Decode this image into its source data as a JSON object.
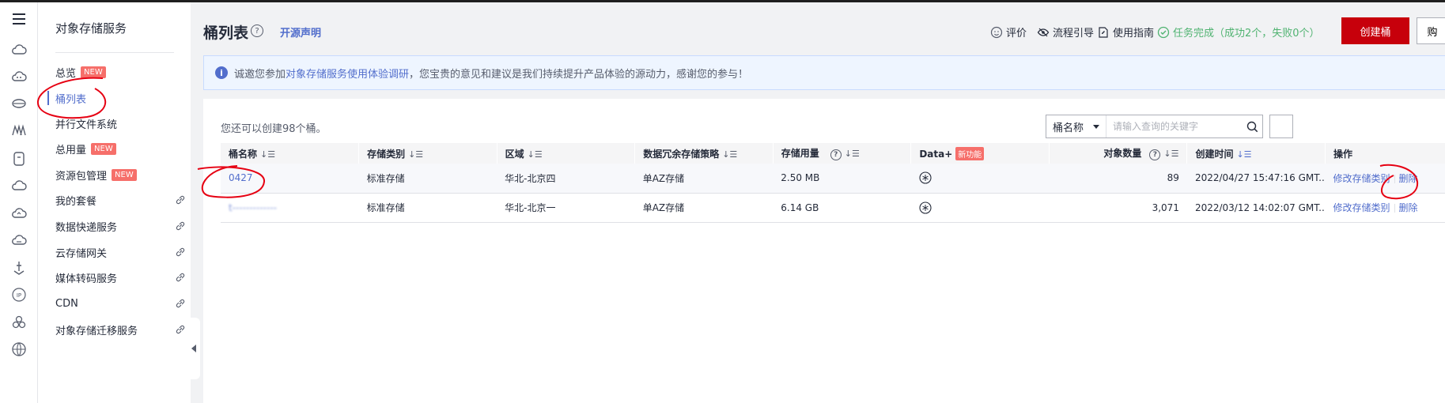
{
  "rail_icons": [
    "menu-icon",
    "cloud-icon",
    "cloud-server-icon",
    "storage-disk-icon",
    "ma-icon",
    "bucket-icon",
    "cloud-icon",
    "cloud-outline-icon",
    "cloud-sync-icon",
    "ship-icon",
    "ip-icon",
    "cluster-icon",
    "globe-icon"
  ],
  "nav": {
    "service_title": "对象存储服务",
    "items": [
      {
        "label": "总览",
        "badge": "NEW"
      },
      {
        "label": "桶列表",
        "badge": ""
      },
      {
        "label": "并行文件系统",
        "badge": ""
      },
      {
        "label": "总用量",
        "badge": "NEW"
      },
      {
        "label": "资源包管理",
        "badge": "NEW"
      },
      {
        "label": "我的套餐",
        "badge": ""
      },
      {
        "label": "数据快递服务",
        "badge": ""
      },
      {
        "label": "云存储网关",
        "badge": ""
      },
      {
        "label": "媒体转码服务",
        "badge": ""
      },
      {
        "label": "CDN",
        "badge": ""
      },
      {
        "label": "对象存储迁移服务",
        "badge": ""
      }
    ]
  },
  "header": {
    "title": "桶列表",
    "help": "?",
    "open_source_link": "开源声明",
    "rate": "评价",
    "guide": "流程引导",
    "manual": "使用指南",
    "task_status": "任务完成（成功2个，失败0个）",
    "create_button": "创建桶",
    "side_button": "购"
  },
  "notice": {
    "prefix": "诚邀您参加",
    "link": "对象存储服务使用体验调研",
    "suffix": "，您宝贵的意见和建议是我们持续提升产品体验的源动力，感谢您的参与！"
  },
  "toolbar": {
    "quota_text": "您还可以创建98个桶。",
    "search_field": "桶名称",
    "search_placeholder": "请输入查询的关键字"
  },
  "table": {
    "headers": {
      "name": "桶名称",
      "type": "存储类别",
      "region": "区域",
      "redundancy": "数据冗余存储策略",
      "usage": "存储用量",
      "dataplus": "Data+",
      "dataplus_badge": "新功能",
      "objects": "对象数量",
      "created": "创建时间",
      "ops": "操作"
    },
    "rows": [
      {
        "name": "0427",
        "type": "标准存储",
        "region": "华北-北京四",
        "redundancy": "单AZ存储",
        "usage": "2.50 MB",
        "objects": "89",
        "created": "2022/04/27 15:47:16 GMT...",
        "op_modify": "修改存储类别",
        "op_delete": "删除"
      },
      {
        "name": "t-------------",
        "type": "标准存储",
        "region": "华北-北京一",
        "redundancy": "单AZ存储",
        "usage": "6.14 GB",
        "objects": "3,071",
        "created": "2022/03/12 14:02:07 GMT...",
        "op_modify": "修改存储类别",
        "op_delete": "删除"
      }
    ]
  },
  "colors": {
    "primary": "#526ecc",
    "danger": "#c7000b",
    "success": "#50b371",
    "annotation": "#e60012"
  }
}
